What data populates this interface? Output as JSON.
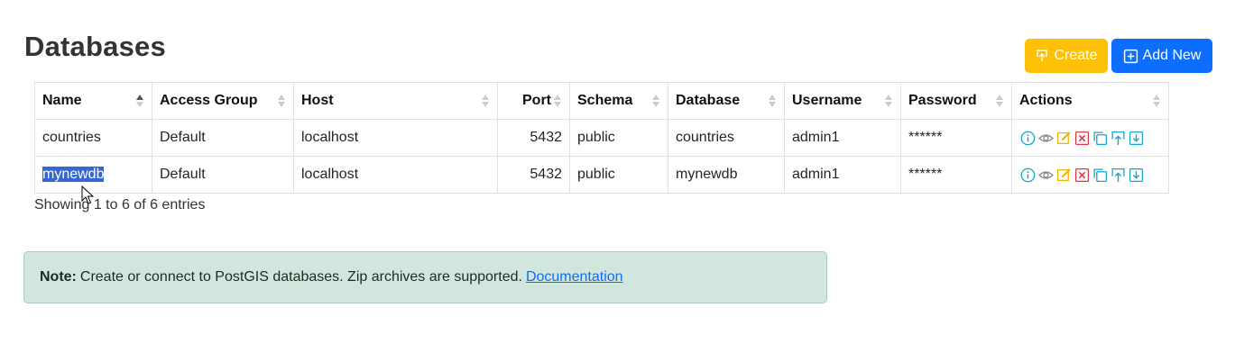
{
  "page": {
    "title": "Databases"
  },
  "toolbar": {
    "create_label": "Create",
    "add_new_label": "Add New"
  },
  "table": {
    "columns": [
      "Name",
      "Access Group",
      "Host",
      "Port",
      "Schema",
      "Database",
      "Username",
      "Password",
      "Actions"
    ],
    "rows": [
      {
        "name": "countries",
        "access_group": "Default",
        "host": "localhost",
        "port": "5432",
        "schema": "public",
        "database": "countries",
        "username": "admin1",
        "password": "******"
      },
      {
        "name": "mynewdb",
        "access_group": "Default",
        "host": "localhost",
        "port": "5432",
        "schema": "public",
        "database": "mynewdb",
        "username": "admin1",
        "password": "******"
      }
    ],
    "info": "Showing 1 to 6 of 6 entries"
  },
  "note": {
    "label": "Note:",
    "text": "Create or connect to PostGIS databases. Zip archives are supported.",
    "link_text": "Documentation"
  },
  "colors": {
    "create": "#ffc107",
    "add_new": "#0d6efd",
    "note_bg": "#d1e7dd",
    "selection": "#3467d1"
  },
  "icons": [
    "info-icon",
    "eye-icon",
    "edit-icon",
    "delete-icon",
    "copy-icon",
    "upload-icon",
    "download-icon"
  ]
}
